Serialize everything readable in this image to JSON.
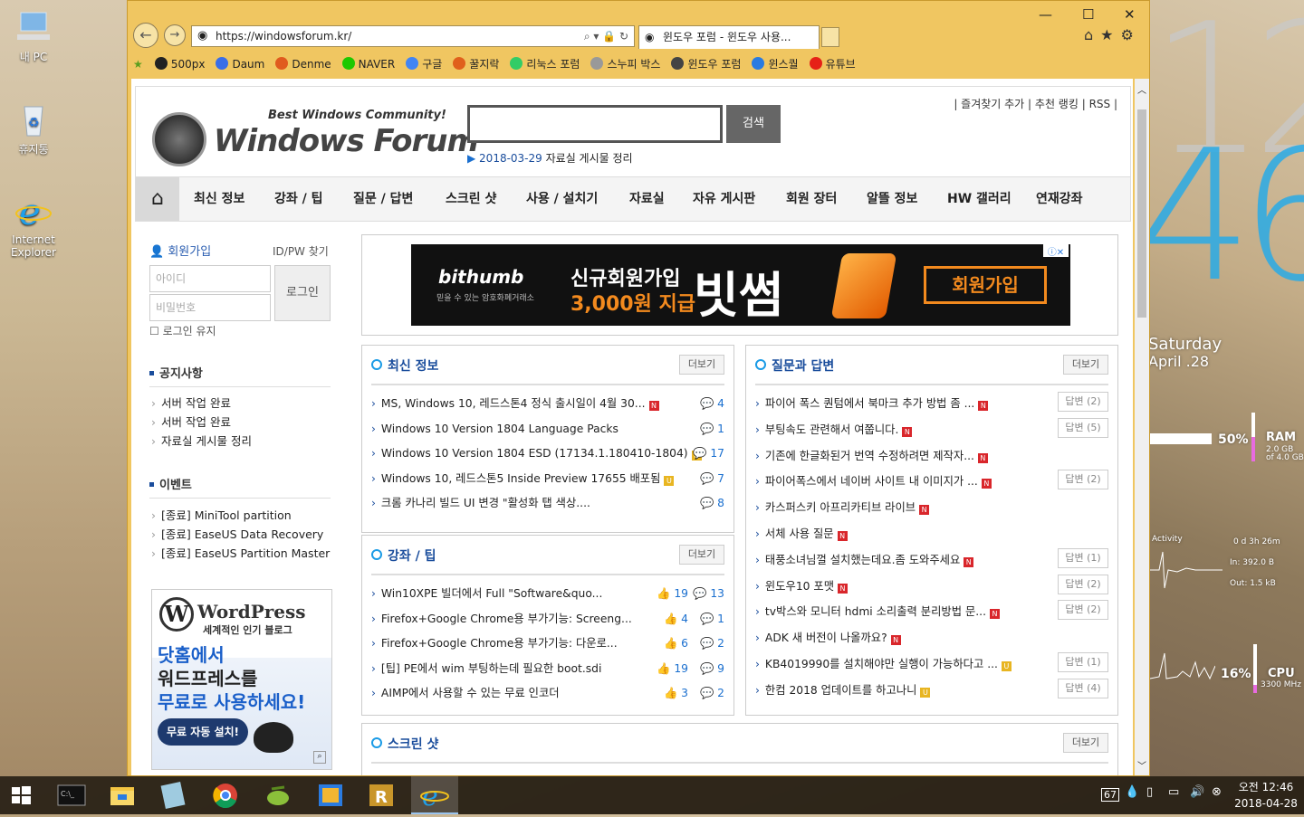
{
  "desktop": {
    "icons": [
      {
        "label": "내 PC"
      },
      {
        "label": "휴지통"
      },
      {
        "label": "Internet Explorer"
      }
    ],
    "clock_hour": "12",
    "clock_min": "46",
    "clock_day": "Saturday",
    "clock_date": "April .28",
    "ram_pct": "50%",
    "ram_label": "RAM",
    "ram_detail1": "2.0 GB",
    "ram_detail2": "of 4.0 GB",
    "net_activity": "Activity",
    "net_uptime": "0 d 3h 26m",
    "net_in": "In: 392.0 B",
    "net_out": "Out: 1.5 kB",
    "cpu_pct": "16%",
    "cpu_label": "CPU",
    "cpu_freq": "3300 MHz"
  },
  "browser": {
    "address": "https://windowsforum.kr/",
    "tab_title": "윈도우 포럼 - 윈도우 사용...",
    "favorites": [
      {
        "label": "500px",
        "color": "#222"
      },
      {
        "label": "Daum",
        "color": "#3a6ee8"
      },
      {
        "label": "Denme",
        "color": "#e05a1e"
      },
      {
        "label": "NAVER",
        "color": "#1ec800"
      },
      {
        "label": "구글",
        "color": "#4285f4"
      },
      {
        "label": "꿀지락",
        "color": "#e0601c"
      },
      {
        "label": "리눅스 포럼",
        "color": "#3c6"
      },
      {
        "label": "스누피 박스",
        "color": "#999"
      },
      {
        "label": "윈도우 포럼",
        "color": "#444"
      },
      {
        "label": "윈스퀄",
        "color": "#2a7be0"
      },
      {
        "label": "유튜브",
        "color": "#e62117"
      }
    ]
  },
  "site": {
    "tagline": "Best Windows Community!",
    "logo": "Windows Forum",
    "search_btn": "검색",
    "notice_date": "2018-03-29",
    "notice_text": "자료실 게시물 정리",
    "toplinks": [
      "즐겨찾기 추가",
      "추천 랭킹",
      "RSS"
    ],
    "menu": [
      "최신 정보",
      "강좌 / 팁",
      "질문 / 답변",
      "스크린 샷",
      "사용 / 설치기",
      "자료실",
      "자유 게시판",
      "회원 장터",
      "알뜰 정보",
      "HW 갤러리",
      "연재강좌"
    ],
    "login": {
      "join": "회원가입",
      "find": "ID/PW 찾기",
      "id_ph": "아이디",
      "pw_ph": "비밀번호",
      "btn": "로그인",
      "keep": "로그인 유지"
    },
    "notice_title": "공지사항",
    "notices": [
      "서버 작업 완료",
      "서버 작업 완료",
      "자료실 게시물 정리"
    ],
    "event_title": "이벤트",
    "events": [
      "[종료] MiniTool partition",
      "[종료] EaseUS Data Recovery",
      "[종료] EaseUS Partition Master"
    ],
    "wp": {
      "brand": "WordPress",
      "sub": "세계적인 인기 블로그",
      "l1": "닷홈에서",
      "l2": "워드프레스를",
      "l3": "무료로 사용하세요!",
      "btn": "무료 자동 설치!"
    },
    "ad": {
      "brand": "bithumb",
      "brand_sub": "믿을 수 있는 암호화폐거래소",
      "l1": "신규회원가입",
      "l2": "3,000원 지급",
      "big": "빗썸",
      "btn": "회원가입"
    },
    "more": "더보기",
    "latest": {
      "title": "최신 정보",
      "rows": [
        {
          "t": "MS, Windows 10, 레드스톤4 정식 출시일이 4월 30...",
          "b": "N",
          "c": "4"
        },
        {
          "t": "Windows 10 Version 1804 Language Packs",
          "b": "",
          "c": "1"
        },
        {
          "t": "Windows 10 Version 1804 ESD (17134.1.180410-1804)",
          "b": "U",
          "c": "17"
        },
        {
          "t": "Windows 10, 레드스톤5 Inside Preview 17655 배포됨",
          "b": "U",
          "c": "7"
        },
        {
          "t": "크롬 카나리 빌드 UI 변경 \"활성화 탭 색상....",
          "b": "",
          "c": "8"
        }
      ]
    },
    "tips": {
      "title": "강좌 / 팁",
      "rows": [
        {
          "t": "Win10XPE 빌더에서 Full \"Software&quo...",
          "l": "19",
          "c": "13"
        },
        {
          "t": "Firefox+Google Chrome용 부가기능: Screeng...",
          "l": "4",
          "c": "1"
        },
        {
          "t": "Firefox+Google Chrome용 부가기능: 다운로...",
          "l": "6",
          "c": "2"
        },
        {
          "t": "[팁] PE에서 wim 부팅하는데 필요한 boot.sdi",
          "l": "19",
          "c": "9"
        },
        {
          "t": "AIMP에서 사용할 수 있는 무료 인코더",
          "l": "3",
          "c": "2"
        }
      ]
    },
    "qa": {
      "title": "질문과 답변",
      "rows": [
        {
          "t": "파이어 폭스 퀀텀에서 북마크 추가 방법 좀 ...",
          "b": "N",
          "a": "답변 (2)"
        },
        {
          "t": "부팅속도 관련해서 여쭙니다.",
          "b": "N",
          "a": "답변 (5)"
        },
        {
          "t": "기존에 한글화된거 번역 수정하려면 제작자...",
          "b": "N",
          "a": ""
        },
        {
          "t": "파이어폭스에서 네이버 사이트 내 이미지가 ...",
          "b": "N",
          "a": "답변 (2)"
        },
        {
          "t": "카스퍼스키 아프리카티브 라이브",
          "b": "N",
          "a": ""
        },
        {
          "t": "서체 사용 질문",
          "b": "N",
          "a": ""
        },
        {
          "t": "태풍소녀님껄 설치했는데요.좀 도와주세요",
          "b": "N",
          "a": "답변 (1)"
        },
        {
          "t": "윈도우10 포맷",
          "b": "N",
          "a": "답변 (2)"
        },
        {
          "t": "tv박스와 모니터 hdmi 소리출력 분리방법 문...",
          "b": "N",
          "a": "답변 (2)"
        },
        {
          "t": "ADK 새 버전이 나올까요?",
          "b": "N",
          "a": ""
        },
        {
          "t": "KB4019990를 설치해야만 실행이 가능하다고 ...",
          "b": "U",
          "a": "답변 (1)"
        },
        {
          "t": "한컴 2018 업데이트를 하고나니",
          "b": "U",
          "a": "답변 (4)"
        }
      ]
    },
    "screens": {
      "title": "스크린 샷"
    }
  },
  "taskbar": {
    "tray_badge": "67",
    "time": "오전 12:46",
    "date": "2018-04-28"
  }
}
